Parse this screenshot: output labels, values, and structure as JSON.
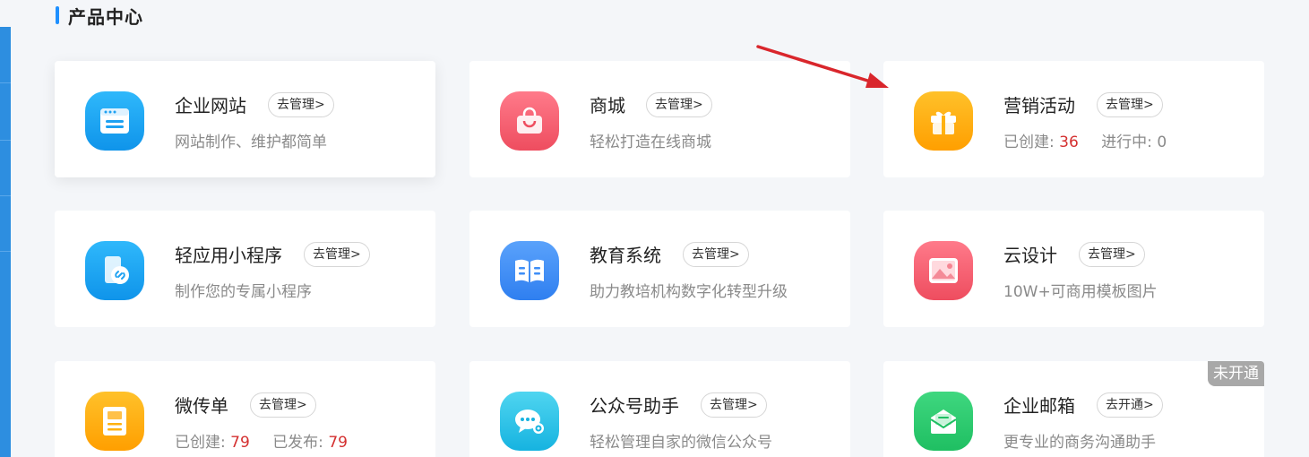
{
  "section": {
    "title": "产品中心"
  },
  "cards": [
    {
      "name": "企业网站",
      "manage": "去管理>",
      "desc": "网站制作、维护都简单",
      "icon": "website-icon",
      "color": "#1da1f2"
    },
    {
      "name": "商城",
      "manage": "去管理>",
      "desc": "轻松打造在线商城",
      "icon": "shopping-bag-icon",
      "color": "#f0586a"
    },
    {
      "name": "营销活动",
      "manage": "去管理>",
      "icon": "gift-icon",
      "color": "#ffae0f",
      "stats": {
        "created_label": "已创建:",
        "created": "36",
        "running_label": "进行中:",
        "running": "0"
      }
    },
    {
      "name": "轻应用小程序",
      "manage": "去管理>",
      "desc": "制作您的专属小程序",
      "icon": "mini-program-icon",
      "color": "#1da1f2"
    },
    {
      "name": "教育系统",
      "manage": "去管理>",
      "desc": "助力教培机构数字化转型升级",
      "icon": "book-icon",
      "color": "#3e8ef7"
    },
    {
      "name": "云设计",
      "manage": "去管理>",
      "desc": "10W+可商用模板图片",
      "icon": "image-icon",
      "color": "#f0586a"
    },
    {
      "name": "微传单",
      "manage": "去管理>",
      "icon": "flyer-icon",
      "color": "#ffae0f",
      "stats": {
        "created_label": "已创建:",
        "created": "79",
        "published_label": "已发布:",
        "published": "79"
      }
    },
    {
      "name": "公众号助手",
      "manage": "去管理>",
      "desc": "轻松管理自家的微信公众号",
      "icon": "wechat-settings-icon",
      "color": "#28c5e8"
    },
    {
      "name": "企业邮箱",
      "manage": "去开通>",
      "desc": "更专业的商务沟通助手",
      "icon": "mail-icon",
      "color": "#2ecc71",
      "badge": "未开通"
    }
  ],
  "colors": {
    "accent": "#1e90ff",
    "stat_highlight": "#d43030",
    "annotation_arrow": "#d9262c"
  }
}
